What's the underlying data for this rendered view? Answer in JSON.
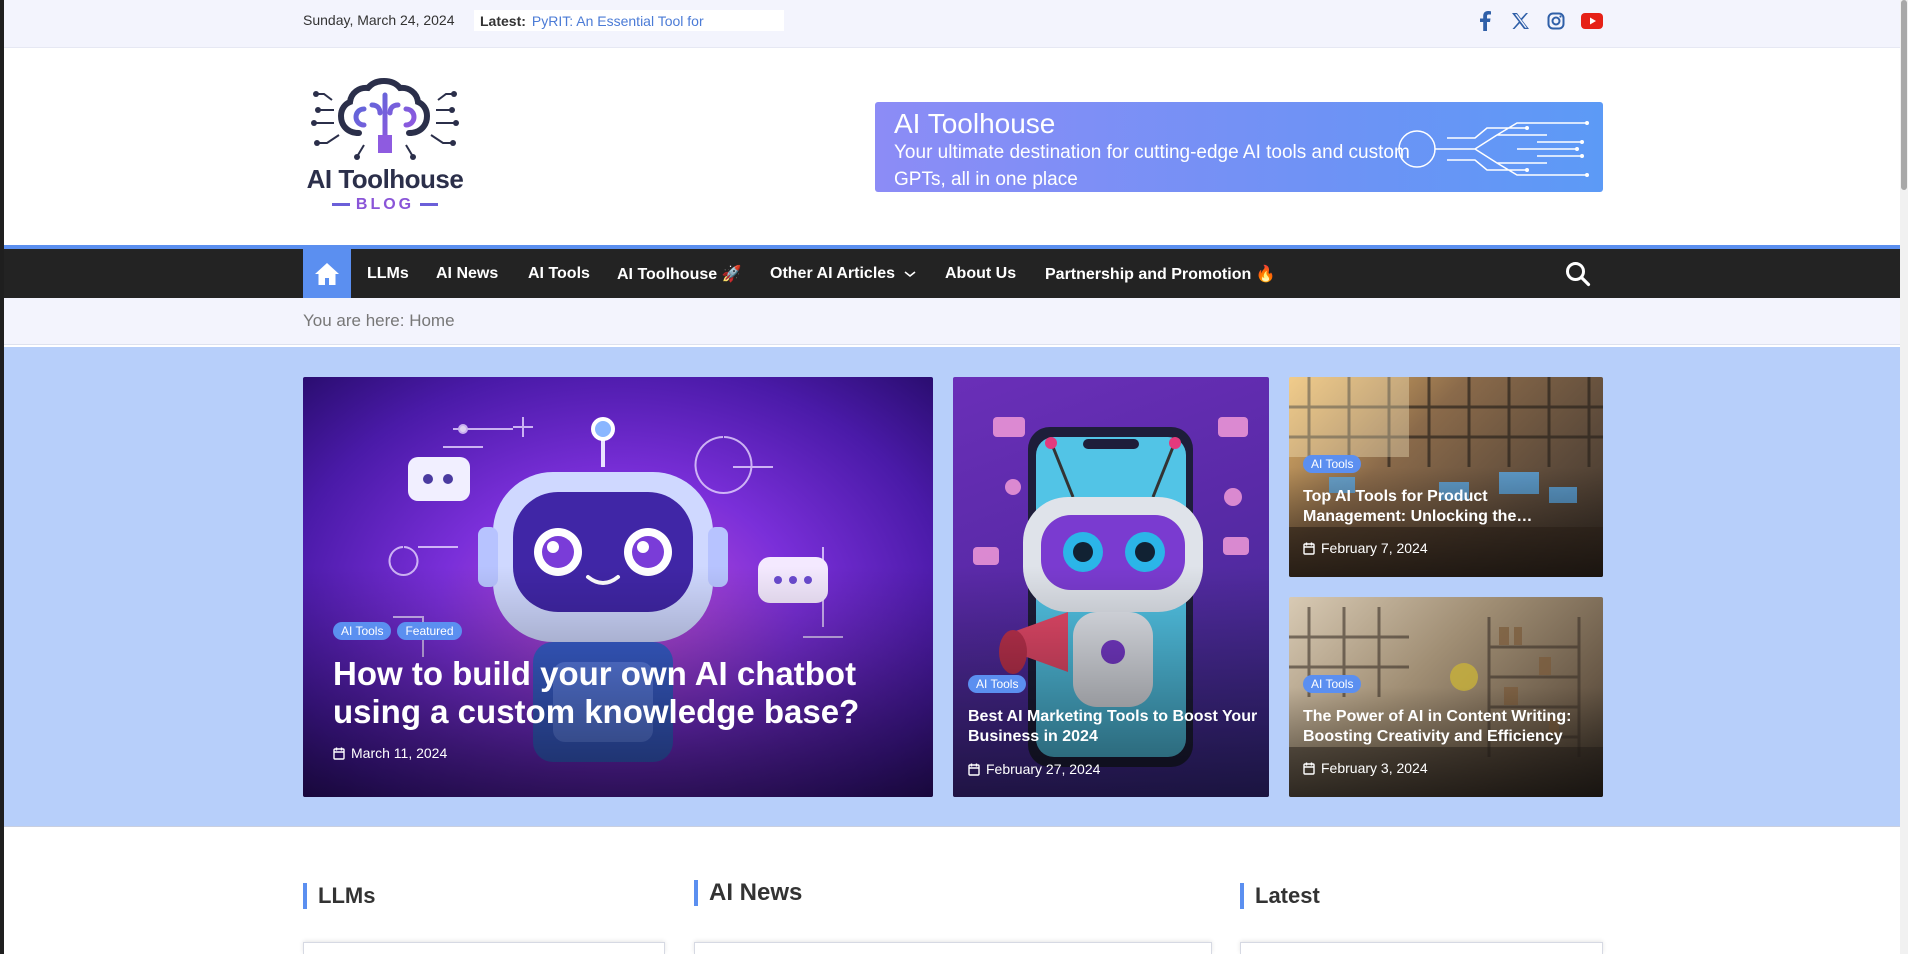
{
  "topbar": {
    "date": "Sunday, March 24, 2024",
    "latest_label": "Latest:",
    "latest_link": "PyRIT: An Essential Tool for",
    "social": [
      "facebook-icon",
      "x-icon",
      "instagram-icon",
      "youtube-icon"
    ]
  },
  "header": {
    "logo_title": "AI Toolhouse",
    "logo_subtitle": "BLOG",
    "banner_title": "AI Toolhouse",
    "banner_subtitle": "Your ultimate destination for cutting-edge AI tools and custom GPTs, all in one place"
  },
  "nav": {
    "items": [
      {
        "label": "LLMs"
      },
      {
        "label": "AI News"
      },
      {
        "label": "AI Tools"
      },
      {
        "label": "AI Toolhouse 🚀"
      },
      {
        "label": "Other AI Articles"
      },
      {
        "label": "About Us"
      },
      {
        "label": "Partnership and Promotion 🔥"
      }
    ]
  },
  "breadcrumb": {
    "prefix": "You are here:",
    "current": "Home"
  },
  "featured": {
    "main": {
      "categories": [
        "AI Tools",
        "Featured"
      ],
      "title": "How to build your own AI chatbot using a custom knowledge base?",
      "date": "March 11, 2024"
    },
    "middle": {
      "category": "AI Tools",
      "title": "Best AI Marketing Tools to Boost Your Business in 2024",
      "date": "February 27, 2024"
    },
    "top_right": {
      "category": "AI Tools",
      "title": "Top AI Tools for Product Management: Unlocking the…",
      "date": "February 7, 2024"
    },
    "bottom_right": {
      "category": "AI Tools",
      "title": "The Power of AI in Content Writing: Boosting Creativity and Efficiency",
      "date": "February 3, 2024"
    }
  },
  "sections": {
    "llms": "LLMs",
    "ai_news": "AI News",
    "latest": "Latest"
  },
  "colors": {
    "accent": "#5b8ff0",
    "nav_bg": "#232323",
    "featured_bg": "#b7cffa",
    "topbar_bg": "#f3f4fd"
  }
}
